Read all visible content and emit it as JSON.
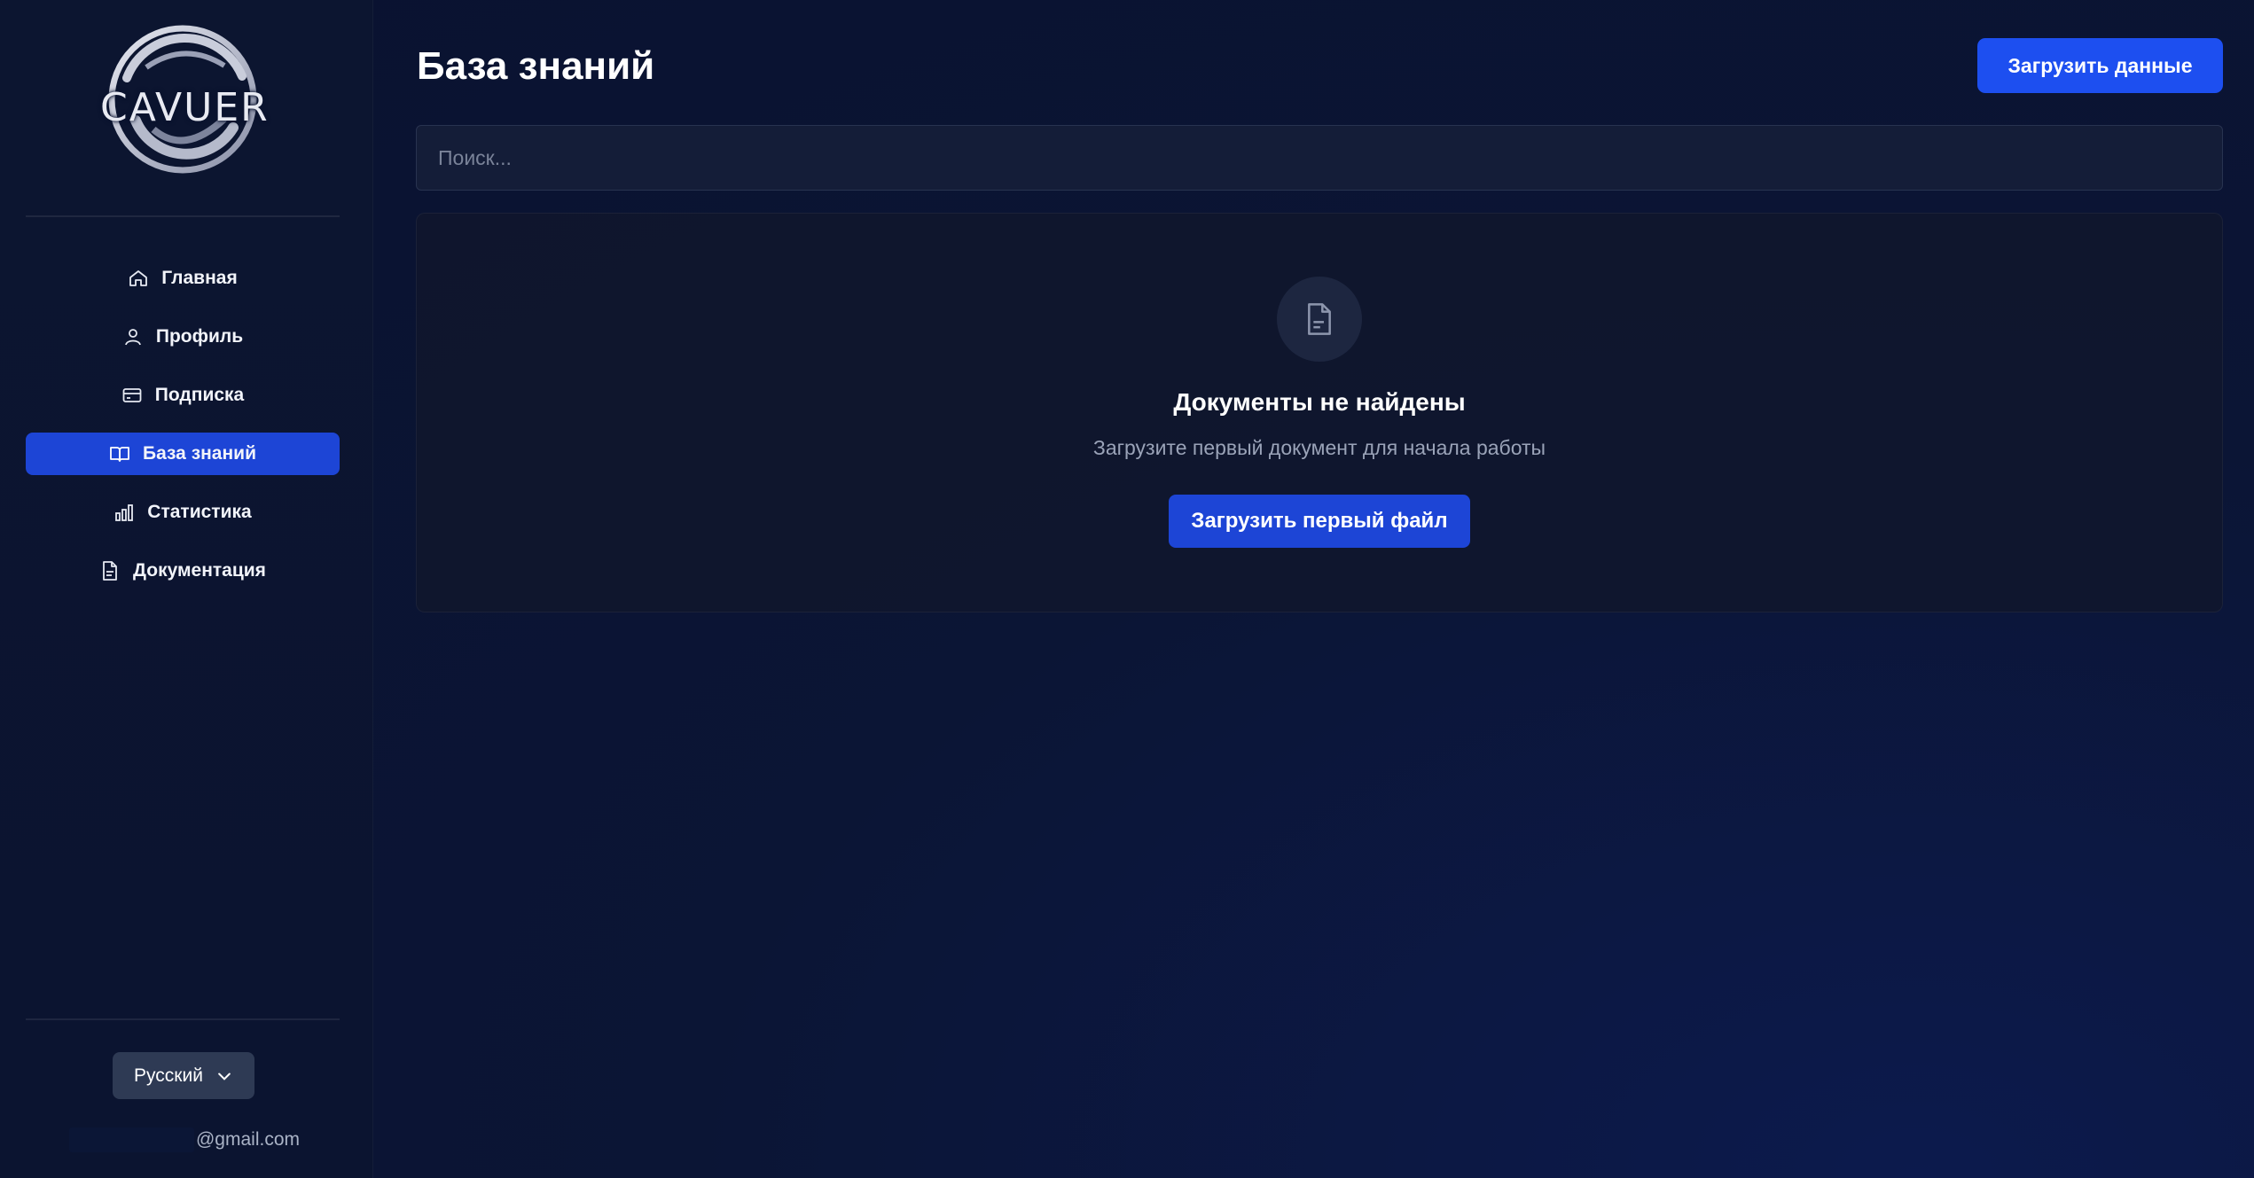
{
  "app": {
    "logo_text": "CAVUER"
  },
  "sidebar": {
    "items": [
      {
        "label": "Главная",
        "icon": "home-icon"
      },
      {
        "label": "Профиль",
        "icon": "user-icon"
      },
      {
        "label": "Подписка",
        "icon": "credit-card-icon"
      },
      {
        "label": "База знаний",
        "icon": "book-icon",
        "active": true
      },
      {
        "label": "Статистика",
        "icon": "bar-chart-icon"
      },
      {
        "label": "Документация",
        "icon": "file-text-icon"
      }
    ],
    "language": "Русский",
    "email": "@gmail.com"
  },
  "main": {
    "title": "База знаний",
    "upload_button": "Загрузить данные",
    "search_placeholder": "Поиск...",
    "empty": {
      "icon": "file-icon",
      "title": "Документы не найдены",
      "subtitle": "Загрузите первый документ для начала работы",
      "button": "Загрузить первый файл"
    }
  },
  "colors": {
    "accent": "#1d4ff0",
    "active_nav": "#1d45d6",
    "background": "#0b1535"
  }
}
